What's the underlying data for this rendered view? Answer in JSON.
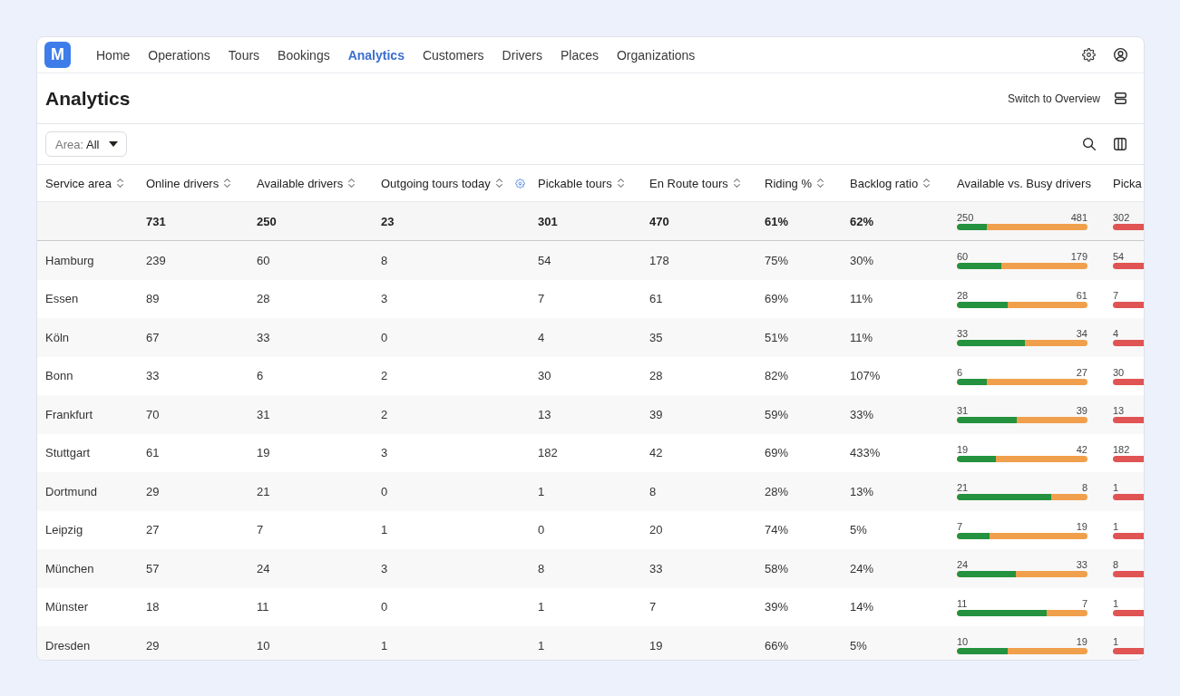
{
  "app": {
    "logo": "M",
    "nav": [
      {
        "label": "Home",
        "selected": false
      },
      {
        "label": "Operations",
        "selected": false
      },
      {
        "label": "Tours",
        "selected": false
      },
      {
        "label": "Bookings",
        "selected": false
      },
      {
        "label": "Analytics",
        "selected": true
      },
      {
        "label": "Customers",
        "selected": false
      },
      {
        "label": "Drivers",
        "selected": false
      },
      {
        "label": "Places",
        "selected": false
      },
      {
        "label": "Organizations",
        "selected": false
      }
    ]
  },
  "page": {
    "title": "Analytics",
    "switch_view": "Switch to Overview"
  },
  "toolbar": {
    "area_filter": {
      "label": "Area:",
      "value": "All"
    }
  },
  "table": {
    "columns": [
      {
        "label": "Service area",
        "sortable": true,
        "settings_icon": false
      },
      {
        "label": "Online drivers",
        "sortable": true,
        "settings_icon": false
      },
      {
        "label": "Available drivers",
        "sortable": true,
        "settings_icon": false
      },
      {
        "label": "Outgoing tours today",
        "sortable": true,
        "settings_icon": true
      },
      {
        "label": "Pickable tours",
        "sortable": true,
        "settings_icon": false
      },
      {
        "label": "En Route tours",
        "sortable": true,
        "settings_icon": false
      },
      {
        "label": "Riding %",
        "sortable": true,
        "settings_icon": false
      },
      {
        "label": "Backlog ratio",
        "sortable": true,
        "settings_icon": false
      },
      {
        "label": "Available vs. Busy drivers",
        "sortable": false,
        "settings_icon": false
      },
      {
        "label": "Picka",
        "sortable": false,
        "settings_icon": false
      }
    ],
    "totals": {
      "values": [
        "731",
        "250",
        "23",
        "301",
        "470",
        "61%",
        "62%"
      ],
      "available_vs_busy": {
        "available": "250",
        "busy": "481",
        "level": 0.23
      },
      "column_10": {
        "value": "302",
        "level": 1
      }
    },
    "rows": [
      {
        "service_area": "Hamburg",
        "values": [
          "239",
          "60",
          "8",
          "54",
          "178",
          "75%",
          "30%"
        ],
        "available_vs_busy": {
          "available": "60",
          "busy": "179",
          "level": 0.34
        },
        "column_10": {
          "value": "54",
          "level": 1
        }
      },
      {
        "service_area": "Essen",
        "values": [
          "89",
          "28",
          "3",
          "7",
          "61",
          "69%",
          "11%"
        ],
        "available_vs_busy": {
          "available": "28",
          "busy": "61",
          "level": 0.39
        },
        "column_10": {
          "value": "7",
          "level": 1
        }
      },
      {
        "service_area": "Köln",
        "values": [
          "67",
          "33",
          "0",
          "4",
          "35",
          "51%",
          "11%"
        ],
        "available_vs_busy": {
          "available": "33",
          "busy": "34",
          "level": 0.52
        },
        "column_10": {
          "value": "4",
          "level": 1
        }
      },
      {
        "service_area": "Bonn",
        "values": [
          "33",
          "6",
          "2",
          "30",
          "28",
          "82%",
          "107%"
        ],
        "available_vs_busy": {
          "available": "6",
          "busy": "27",
          "level": 0.23
        },
        "column_10": {
          "value": "30",
          "level": 1
        }
      },
      {
        "service_area": "Frankfurt",
        "values": [
          "70",
          "31",
          "2",
          "13",
          "39",
          "59%",
          "33%"
        ],
        "available_vs_busy": {
          "available": "31",
          "busy": "39",
          "level": 0.46
        },
        "column_10": {
          "value": "13",
          "level": 1
        }
      },
      {
        "service_area": "Stuttgart",
        "values": [
          "61",
          "19",
          "3",
          "182",
          "42",
          "69%",
          "433%"
        ],
        "available_vs_busy": {
          "available": "19",
          "busy": "42",
          "level": 0.3
        },
        "column_10": {
          "value": "182",
          "level": 1
        }
      },
      {
        "service_area": "Dortmund",
        "values": [
          "29",
          "21",
          "0",
          "1",
          "8",
          "28%",
          "13%"
        ],
        "available_vs_busy": {
          "available": "21",
          "busy": "8",
          "level": 0.72
        },
        "column_10": {
          "value": "1",
          "level": 1
        }
      },
      {
        "service_area": "Leipzig",
        "values": [
          "27",
          "7",
          "1",
          "0",
          "20",
          "74%",
          "5%"
        ],
        "available_vs_busy": {
          "available": "7",
          "busy": "19",
          "level": 0.25
        },
        "column_10": {
          "value": "1",
          "level": 1
        }
      },
      {
        "service_area": "München",
        "values": [
          "57",
          "24",
          "3",
          "8",
          "33",
          "58%",
          "24%"
        ],
        "available_vs_busy": {
          "available": "24",
          "busy": "33",
          "level": 0.45
        },
        "column_10": {
          "value": "8",
          "level": 1
        }
      },
      {
        "service_area": "Münster",
        "values": [
          "18",
          "11",
          "0",
          "1",
          "7",
          "39%",
          "14%"
        ],
        "available_vs_busy": {
          "available": "11",
          "busy": "7",
          "level": 0.69
        },
        "column_10": {
          "value": "1",
          "level": 1
        }
      },
      {
        "service_area": "Dresden",
        "values": [
          "29",
          "10",
          "1",
          "1",
          "19",
          "66%",
          "5%"
        ],
        "available_vs_busy": {
          "available": "10",
          "busy": "19",
          "level": 0.39
        },
        "column_10": {
          "value": "1",
          "level": 1
        }
      }
    ]
  }
}
